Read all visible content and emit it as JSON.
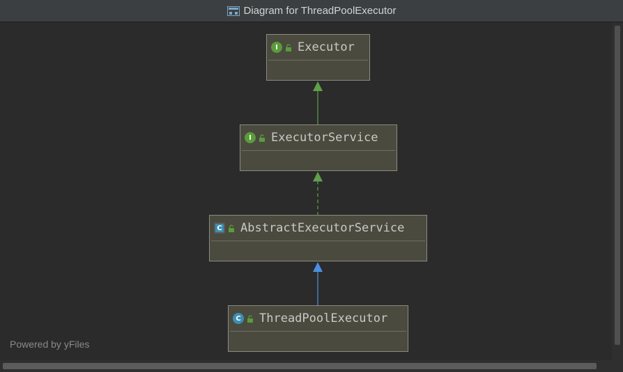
{
  "window": {
    "title": "Diagram for ThreadPoolExecutor"
  },
  "nodes": [
    {
      "name": "Executor",
      "kind": "interface",
      "kind_letter": "I"
    },
    {
      "name": "ExecutorService",
      "kind": "interface",
      "kind_letter": "I"
    },
    {
      "name": "AbstractExecutorService",
      "kind": "abstract-class",
      "kind_letter": "C"
    },
    {
      "name": "ThreadPoolExecutor",
      "kind": "class",
      "kind_letter": "C"
    }
  ],
  "edges": [
    {
      "from": "ExecutorService",
      "to": "Executor",
      "type": "extends",
      "color": "#5fa04a"
    },
    {
      "from": "AbstractExecutorService",
      "to": "ExecutorService",
      "type": "implements",
      "color": "#5fa04a"
    },
    {
      "from": "ThreadPoolExecutor",
      "to": "AbstractExecutorService",
      "type": "extends",
      "color": "#4d8fe0"
    }
  ],
  "footer": {
    "watermark": "Powered by yFiles"
  },
  "colors": {
    "background": "#2b2b2b",
    "node_fill": "#4a4a3e",
    "node_border": "#8b8b80",
    "interface_badge": "#5a9b3b",
    "class_badge": "#3c8fb0"
  }
}
